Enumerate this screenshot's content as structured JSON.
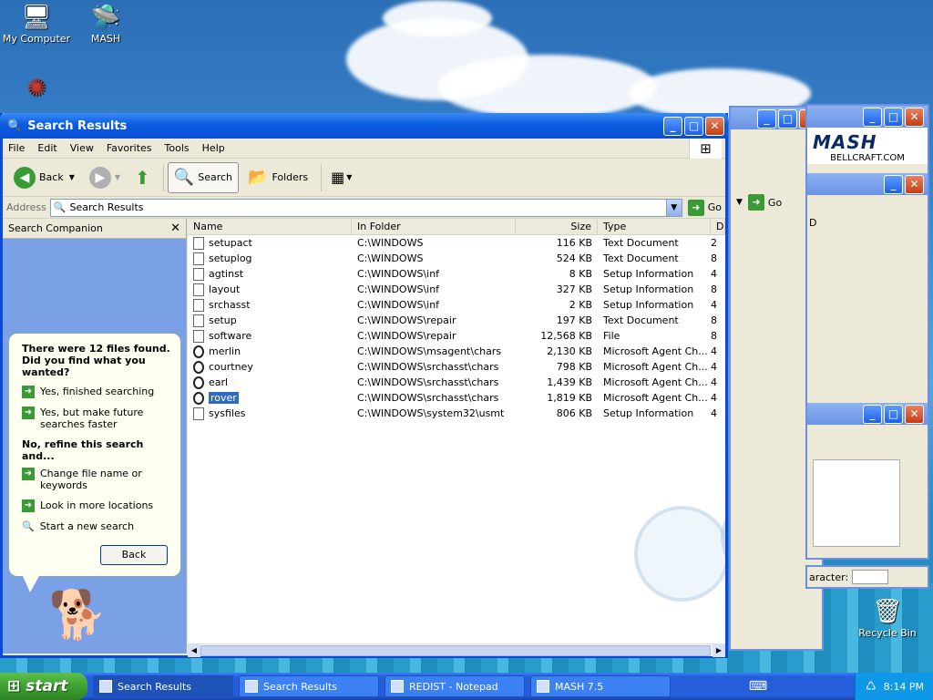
{
  "desktop": {
    "icons": [
      {
        "label": "My Computer"
      },
      {
        "label": "MASH"
      },
      {
        "label": "Recycle Bin"
      }
    ]
  },
  "window": {
    "title": "Search Results",
    "menu": [
      "File",
      "Edit",
      "View",
      "Favorites",
      "Tools",
      "Help"
    ],
    "toolbar": {
      "back": "Back",
      "search": "Search",
      "folders": "Folders"
    },
    "address": {
      "label": "Address",
      "value": "Search Results",
      "go": "Go"
    }
  },
  "companion": {
    "header": "Search Companion",
    "found_text": "There were 12 files found. Did you find what you wanted?",
    "option_yes_done": "Yes, finished searching",
    "option_yes_faster": "Yes, but make future searches faster",
    "refine_text": "No, refine this search and...",
    "option_change": "Change file name or keywords",
    "option_locations": "Look in more locations",
    "option_new": "Start a new search",
    "back_button": "Back"
  },
  "table": {
    "columns": [
      "Name",
      "In Folder",
      "Size",
      "Type",
      "D"
    ],
    "rows": [
      {
        "name": "setupact",
        "folder": "C:\\WINDOWS",
        "size": "116 KB",
        "type": "Text Document",
        "d": "2",
        "icon": "text"
      },
      {
        "name": "setuplog",
        "folder": "C:\\WINDOWS",
        "size": "524 KB",
        "type": "Text Document",
        "d": "8",
        "icon": "text"
      },
      {
        "name": "agtinst",
        "folder": "C:\\WINDOWS\\inf",
        "size": "8 KB",
        "type": "Setup Information",
        "d": "4",
        "icon": "setup"
      },
      {
        "name": "layout",
        "folder": "C:\\WINDOWS\\inf",
        "size": "327 KB",
        "type": "Setup Information",
        "d": "8",
        "icon": "setup"
      },
      {
        "name": "srchasst",
        "folder": "C:\\WINDOWS\\inf",
        "size": "2 KB",
        "type": "Setup Information",
        "d": "4",
        "icon": "setup"
      },
      {
        "name": "setup",
        "folder": "C:\\WINDOWS\\repair",
        "size": "197 KB",
        "type": "Text Document",
        "d": "8",
        "icon": "text"
      },
      {
        "name": "software",
        "folder": "C:\\WINDOWS\\repair",
        "size": "12,568 KB",
        "type": "File",
        "d": "8",
        "icon": "file"
      },
      {
        "name": "merlin",
        "folder": "C:\\WINDOWS\\msagent\\chars",
        "size": "2,130 KB",
        "type": "Microsoft Agent Ch...",
        "d": "4",
        "icon": "agent"
      },
      {
        "name": "courtney",
        "folder": "C:\\WINDOWS\\srchasst\\chars",
        "size": "798 KB",
        "type": "Microsoft Agent Ch...",
        "d": "4",
        "icon": "agent"
      },
      {
        "name": "earl",
        "folder": "C:\\WINDOWS\\srchasst\\chars",
        "size": "1,439 KB",
        "type": "Microsoft Agent Ch...",
        "d": "4",
        "icon": "agent"
      },
      {
        "name": "rover",
        "folder": "C:\\WINDOWS\\srchasst\\chars",
        "size": "1,819 KB",
        "type": "Microsoft Agent Ch...",
        "d": "4",
        "icon": "agent",
        "selected": true
      },
      {
        "name": "sysfiles",
        "folder": "C:\\WINDOWS\\system32\\usmt",
        "size": "806 KB",
        "type": "Setup Information",
        "d": "4",
        "icon": "setup"
      }
    ]
  },
  "background_windows": {
    "mash_logo": "MASH",
    "mash_site": "BELLCRAFT.COM",
    "go": "Go",
    "column_d": "D",
    "character_label": "aracter:"
  },
  "taskbar": {
    "start": "start",
    "tasks": [
      "Search Results",
      "Search Results",
      "REDIST - Notepad",
      "MASH 7.5"
    ],
    "clock": "8:14 PM"
  }
}
